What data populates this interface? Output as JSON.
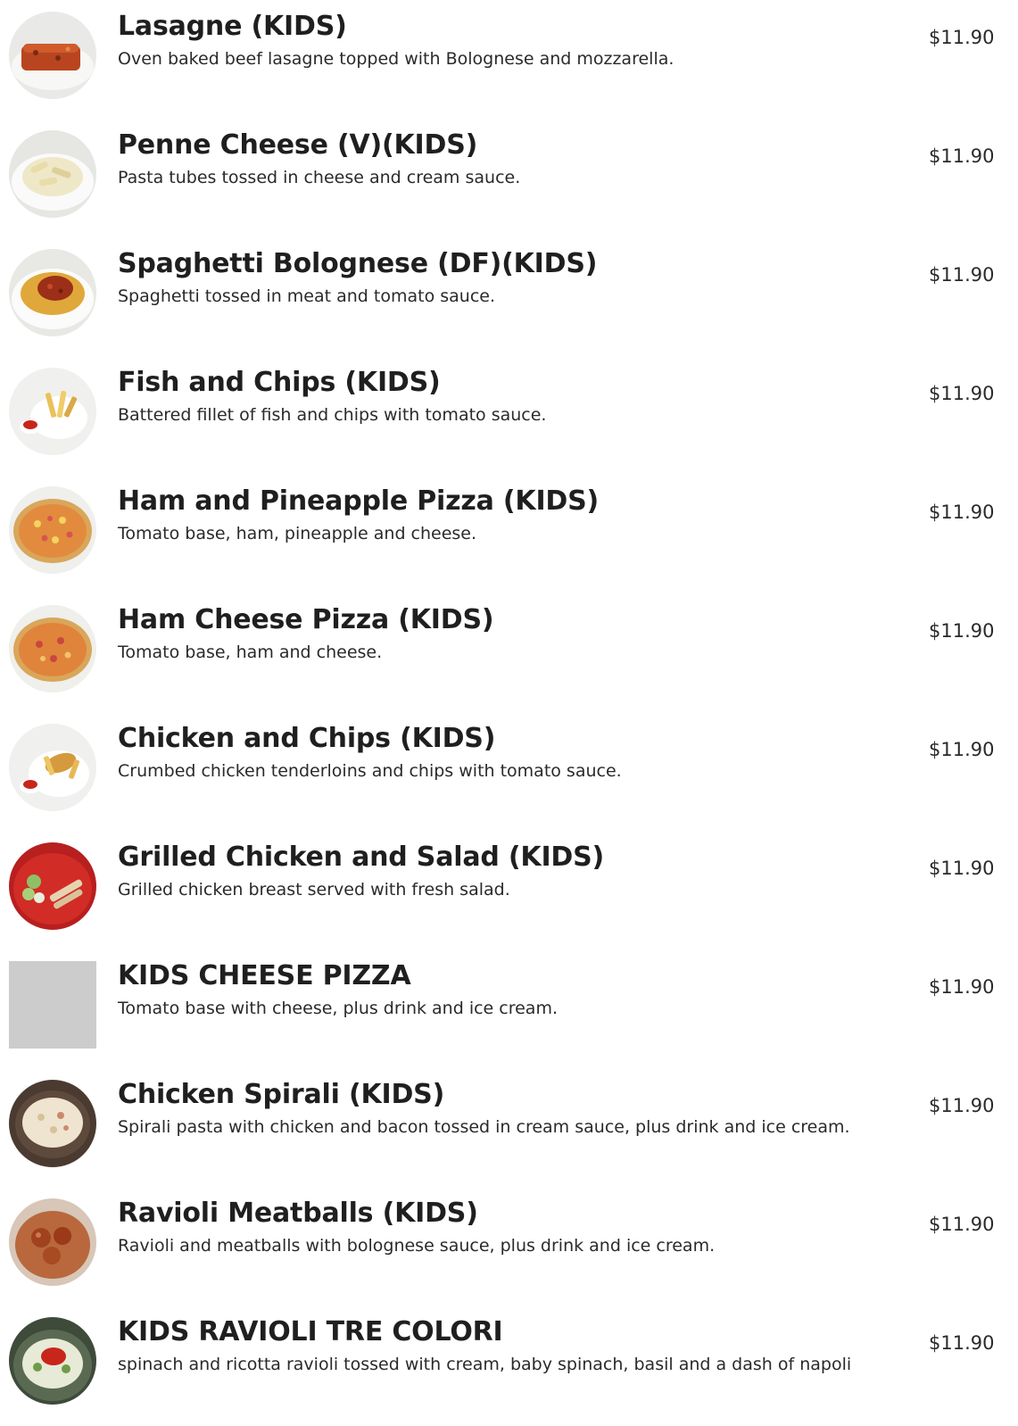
{
  "menu": {
    "items": [
      {
        "title": "Lasagne (KIDS)",
        "description": "Oven baked beef lasagne topped with Bolognese and mozzarella.",
        "price": "$11.90",
        "image": "lasagne-photo"
      },
      {
        "title": "Penne Cheese (V)(KIDS)",
        "description": "Pasta tubes tossed in cheese and cream sauce.",
        "price": "$11.90",
        "image": "penne-cheese-photo"
      },
      {
        "title": "Spaghetti Bolognese (DF)(KIDS)",
        "description": "Spaghetti tossed in meat and tomato sauce.",
        "price": "$11.90",
        "image": "spaghetti-bolognese-photo"
      },
      {
        "title": "Fish and Chips (KIDS)",
        "description": "Battered fillet of fish and chips with tomato sauce.",
        "price": "$11.90",
        "image": "fish-and-chips-photo"
      },
      {
        "title": "Ham and Pineapple Pizza (KIDS)",
        "description": "Tomato base, ham, pineapple and cheese.",
        "price": "$11.90",
        "image": "ham-pineapple-pizza-photo"
      },
      {
        "title": "Ham Cheese Pizza (KIDS)",
        "description": "Tomato base, ham and cheese.",
        "price": "$11.90",
        "image": "ham-cheese-pizza-photo"
      },
      {
        "title": "Chicken and Chips (KIDS)",
        "description": "Crumbed chicken tenderloins and chips with tomato sauce.",
        "price": "$11.90",
        "image": "chicken-and-chips-photo"
      },
      {
        "title": "Grilled Chicken and Salad (KIDS)",
        "description": "Grilled chicken breast served with fresh salad.",
        "price": "$11.90",
        "image": "grilled-chicken-salad-photo"
      },
      {
        "title": "KIDS CHEESE PIZZA",
        "description": "Tomato base with cheese, plus drink and ice cream.",
        "price": "$11.90",
        "image": "placeholder"
      },
      {
        "title": "Chicken Spirali (KIDS)",
        "description": "Spirali pasta with chicken and bacon tossed in cream sauce, plus drink and ice cream.",
        "price": "$11.90",
        "image": "chicken-spirali-photo"
      },
      {
        "title": "Ravioli Meatballs (KIDS)",
        "description": "Ravioli and meatballs with bolognese sauce, plus drink and ice cream.",
        "price": "$11.90",
        "image": "ravioli-meatballs-photo"
      },
      {
        "title": "KIDS RAVIOLI TRE COLORI",
        "description": "spinach and ricotta ravioli tossed with cream, baby spinach, basil and a dash of napoli",
        "price": "$11.90",
        "image": "ravioli-tre-colori-photo"
      }
    ]
  }
}
